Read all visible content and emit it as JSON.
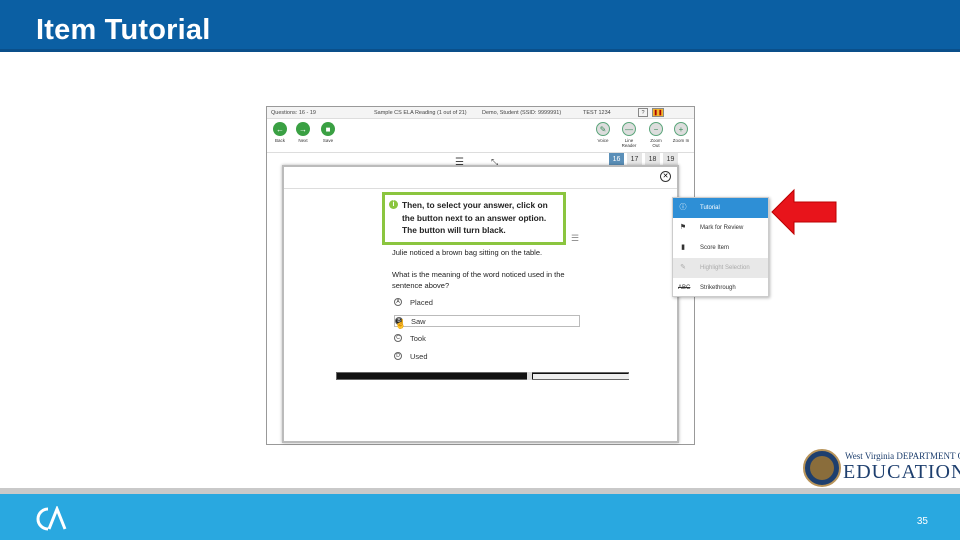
{
  "header": {
    "title": "Item Tutorial"
  },
  "footer": {
    "slide_number": "35",
    "logo": "ca-logo"
  },
  "app": {
    "question_bar": {
      "questions": "Questions: 16 - 19",
      "test": "Sample CS ELA Reading (1 out of 21)",
      "student": "Demo, Student (SSID: 9999991)",
      "session": "TEST 1234"
    },
    "toolbar": [
      {
        "label": "Back",
        "icon": "arrow-left-icon"
      },
      {
        "label": "Next",
        "icon": "arrow-right-icon"
      },
      {
        "label": "Save",
        "icon": "save-icon"
      },
      {
        "label": "Voice",
        "icon": "voice-icon"
      },
      {
        "label": "Line Reader",
        "icon": "line-reader-icon"
      },
      {
        "label": "Zoom Out",
        "icon": "zoom-out-icon"
      },
      {
        "label": "Zoom In",
        "icon": "zoom-in-icon"
      }
    ],
    "question_tabs": [
      "16",
      "17",
      "18",
      "19"
    ],
    "active_tab": "16"
  },
  "dialog": {
    "callout": "Then, to select your answer, click on the button next to an answer option. The button will turn black.",
    "passage": "Julie noticed a brown bag sitting on the table.",
    "question": "What is the meaning of the word noticed used in the sentence above?",
    "options": [
      {
        "letter": "A",
        "text": "Placed",
        "selected": false
      },
      {
        "letter": "B",
        "text": "Saw",
        "selected": true
      },
      {
        "letter": "C",
        "text": "Took",
        "selected": false
      },
      {
        "letter": "D",
        "text": "Used",
        "selected": false
      }
    ]
  },
  "context_menu": [
    {
      "label": "Tutorial",
      "icon": "info-icon",
      "state": "highlighted"
    },
    {
      "label": "Mark for Review",
      "icon": "flag-icon",
      "state": "normal"
    },
    {
      "label": "Score Item",
      "icon": "bar-chart-icon",
      "state": "normal"
    },
    {
      "label": "Highlight Selection",
      "icon": "highlighter-icon",
      "state": "disabled"
    },
    {
      "label": "Strikethrough",
      "icon": "strikethrough-icon",
      "state": "normal"
    }
  ],
  "brand": {
    "org_top": "West Virginia DEPARTMENT OF",
    "org_big": "EDUCATION",
    "accent": "#0b5fa3",
    "footer_color": "#29a8e0",
    "callout_color": "#8bc53f",
    "arrow_color": "#e8141b"
  }
}
